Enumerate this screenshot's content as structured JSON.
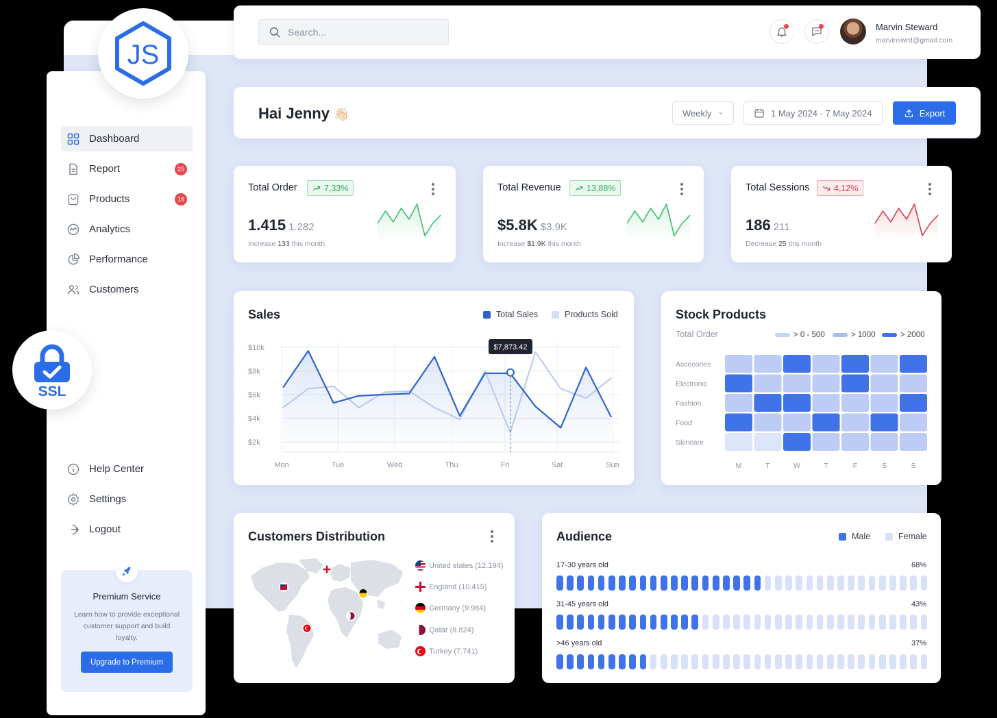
{
  "header": {
    "search_placeholder": "Search...",
    "user": {
      "name": "Marvin Steward",
      "email": "marvinswrd@gmail.com"
    }
  },
  "greeting": {
    "text": "Hai Jenny",
    "emoji": "👋🏻",
    "period": "Weekly",
    "date_range": "1 May 2024 - 7 May 2024",
    "export_label": "Export"
  },
  "sidebar": {
    "items": [
      {
        "label": "Dashboard",
        "icon": "grid-icon"
      },
      {
        "label": "Report",
        "icon": "document-icon",
        "badge": "25"
      },
      {
        "label": "Products",
        "icon": "bag-icon",
        "badge": "18"
      },
      {
        "label": "Analytics",
        "icon": "analytics-icon"
      },
      {
        "label": "Performance",
        "icon": "pie-chart-icon"
      },
      {
        "label": "Customers",
        "icon": "users-icon"
      }
    ],
    "bottom_items": [
      {
        "label": "Help Center",
        "icon": "info-icon"
      },
      {
        "label": "Settings",
        "icon": "gear-icon"
      },
      {
        "label": "Logout",
        "icon": "logout-icon"
      }
    ],
    "premium": {
      "title": "Premium Service",
      "description": "Learn how to provide exceptional customer support and build loyalty.",
      "button": "Upgrade to Premium"
    }
  },
  "badges": {
    "js": "JS",
    "ssl": "SSL"
  },
  "stats": [
    {
      "title": "Total Order",
      "change": "7,33%",
      "trend": "up",
      "value": "1.415",
      "previous": "1.282",
      "note_prefix": "Increase",
      "note_value": "133",
      "note_suffix": "this month",
      "spark": [
        30,
        12,
        28,
        8,
        24,
        2,
        48,
        30,
        18
      ]
    },
    {
      "title": "Total Revenue",
      "change": "13,88%",
      "trend": "up",
      "value": "$5.8K",
      "previous": "$3.9K",
      "note_prefix": "Increase",
      "note_value": "$1.9K",
      "note_suffix": "this month",
      "spark": [
        30,
        12,
        28,
        8,
        24,
        2,
        48,
        30,
        18
      ]
    },
    {
      "title": "Total Sessions",
      "change": "4,12%",
      "trend": "down",
      "value": "186",
      "previous": "211",
      "note_prefix": "Decrease",
      "note_value": "25",
      "note_suffix": "this month",
      "spark": [
        30,
        12,
        28,
        8,
        24,
        2,
        48,
        30,
        18
      ]
    }
  ],
  "sales": {
    "title": "Sales",
    "legend": [
      "Total Sales",
      "Products Sold"
    ],
    "tooltip": "$7,873.42"
  },
  "chart_data": {
    "type": "line",
    "title": "Sales",
    "x": [
      "Mon",
      "Tue",
      "Wed",
      "Thu",
      "Fri",
      "Sat",
      "Sun"
    ],
    "y_ticks": [
      "$10k",
      "$8k",
      "$6k",
      "$4k",
      "$2k"
    ],
    "ylim": [
      1600,
      10400
    ],
    "series": [
      {
        "name": "Total Sales",
        "color": "#2f63c9",
        "values": [
          6600,
          9700,
          5300,
          5900,
          6000,
          6100,
          9200,
          4200,
          7800,
          7800,
          5000,
          3200,
          8300,
          4100
        ]
      },
      {
        "name": "Products Sold",
        "color": "#b7c8ee",
        "values": [
          4900,
          6500,
          6700,
          4900,
          6200,
          6300,
          4900,
          3900,
          8000,
          2800,
          9600,
          6500,
          5700,
          7400
        ]
      }
    ],
    "highlight_value": 7873.42
  },
  "stock": {
    "title": "Stock Products",
    "subtitle": "Total Order",
    "legend": [
      "> 0 - 500",
      "> 1000",
      "> 2000"
    ],
    "rows": [
      "Accecories",
      "Electronic",
      "Fashion",
      "Food",
      "Skincare"
    ],
    "cols": [
      "M",
      "T",
      "W",
      "T",
      "F",
      "S",
      "S"
    ],
    "levels": [
      [
        2,
        2,
        3,
        2,
        3,
        2,
        3
      ],
      [
        3,
        2,
        2,
        2,
        3,
        2,
        2
      ],
      [
        2,
        3,
        3,
        2,
        2,
        2,
        3
      ],
      [
        3,
        2,
        2,
        3,
        2,
        3,
        2
      ],
      [
        1,
        1,
        3,
        2,
        2,
        2,
        2
      ]
    ],
    "colors": {
      "1": "#dde5fa",
      "2": "#bcccf5",
      "3": "#3f73e7"
    }
  },
  "distribution": {
    "title": "Customers Distribution",
    "countries": [
      {
        "label": "United states (12.194)",
        "flag": "us-flag-icon"
      },
      {
        "label": "England (10.415)",
        "flag": "england-flag-icon"
      },
      {
        "label": "Germany (9.984)",
        "flag": "germany-flag-icon"
      },
      {
        "label": "Qatar (8.824)",
        "flag": "qatar-flag-icon"
      },
      {
        "label": "Turkey (7.741)",
        "flag": "turkey-flag-icon"
      }
    ]
  },
  "audience": {
    "title": "Audience",
    "legend": [
      "Male",
      "Female"
    ],
    "groups": [
      {
        "label": "17-30 years old",
        "percent": "68%",
        "filled": 20
      },
      {
        "label": "31-45 years old",
        "percent": "43%",
        "filled": 14
      },
      {
        "label": ">46 years old",
        "percent": "37%",
        "filled": 9
      }
    ],
    "total_bars": 36,
    "colors": {
      "male": "#3f73e7",
      "female": "#d8e1f8"
    }
  }
}
